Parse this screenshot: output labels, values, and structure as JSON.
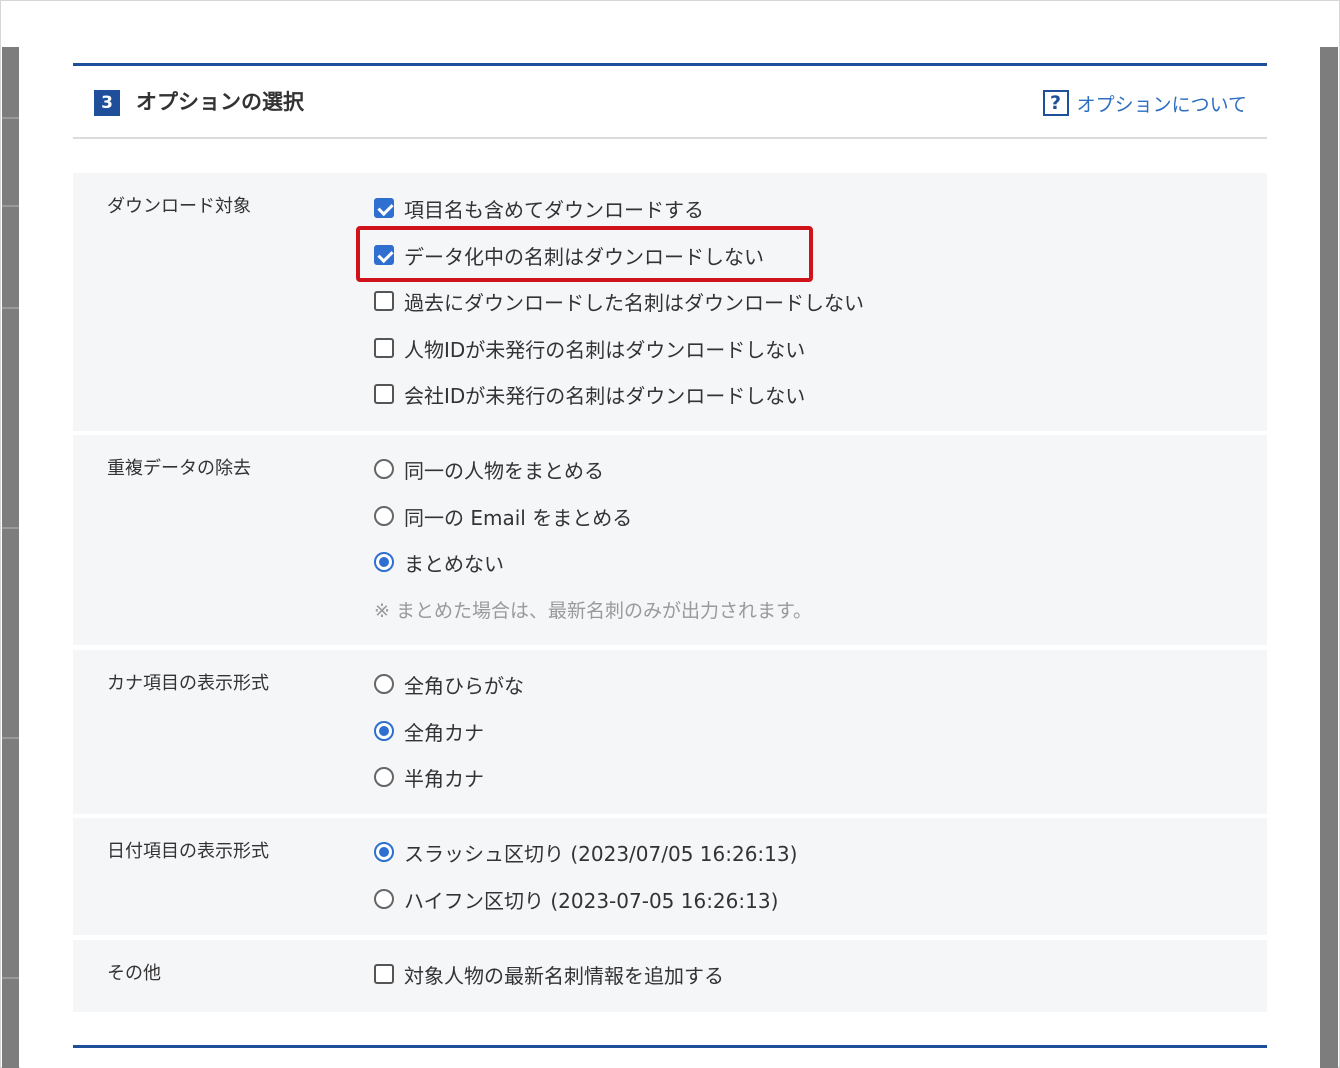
{
  "section": {
    "number": "3",
    "title": "オプションの選択",
    "help_icon": "question-mark-icon",
    "help_label": "オプションについて"
  },
  "download_target": {
    "label": "ダウンロード対象",
    "options": [
      {
        "label": "項目名も含めてダウンロードする",
        "checked": true
      },
      {
        "label": "データ化中の名刺はダウンロードしない",
        "checked": true,
        "highlighted": true
      },
      {
        "label": "過去にダウンロードした名刺はダウンロードしない",
        "checked": false
      },
      {
        "label": "人物IDが未発行の名刺はダウンロードしない",
        "checked": false
      },
      {
        "label": "会社IDが未発行の名刺はダウンロードしない",
        "checked": false
      }
    ]
  },
  "dedupe": {
    "label": "重複データの除去",
    "options": [
      {
        "label": "同一の人物をまとめる",
        "selected": false
      },
      {
        "label": "同一の Email をまとめる",
        "selected": false
      },
      {
        "label": "まとめない",
        "selected": true
      }
    ],
    "note": "※ まとめた場合は、最新名刺のみが出力されます。"
  },
  "kana_format": {
    "label": "カナ項目の表示形式",
    "options": [
      {
        "label": "全角ひらがな",
        "selected": false
      },
      {
        "label": "全角カナ",
        "selected": true
      },
      {
        "label": "半角カナ",
        "selected": false
      }
    ]
  },
  "date_format": {
    "label": "日付項目の表示形式",
    "options": [
      {
        "label": "スラッシュ区切り (2023/07/05 16:26:13)",
        "selected": true
      },
      {
        "label": "ハイフン区切り (2023-07-05 16:26:13)",
        "selected": false
      }
    ]
  },
  "other": {
    "label": "その他",
    "options": [
      {
        "label": "対象人物の最新名刺情報を追加する",
        "checked": false
      }
    ]
  },
  "colors": {
    "accent": "#1f4e9b",
    "link": "#2f6fc2",
    "control_checked": "#2e6fd0",
    "highlight": "#d0121b",
    "row_background": "#f5f6f8"
  }
}
